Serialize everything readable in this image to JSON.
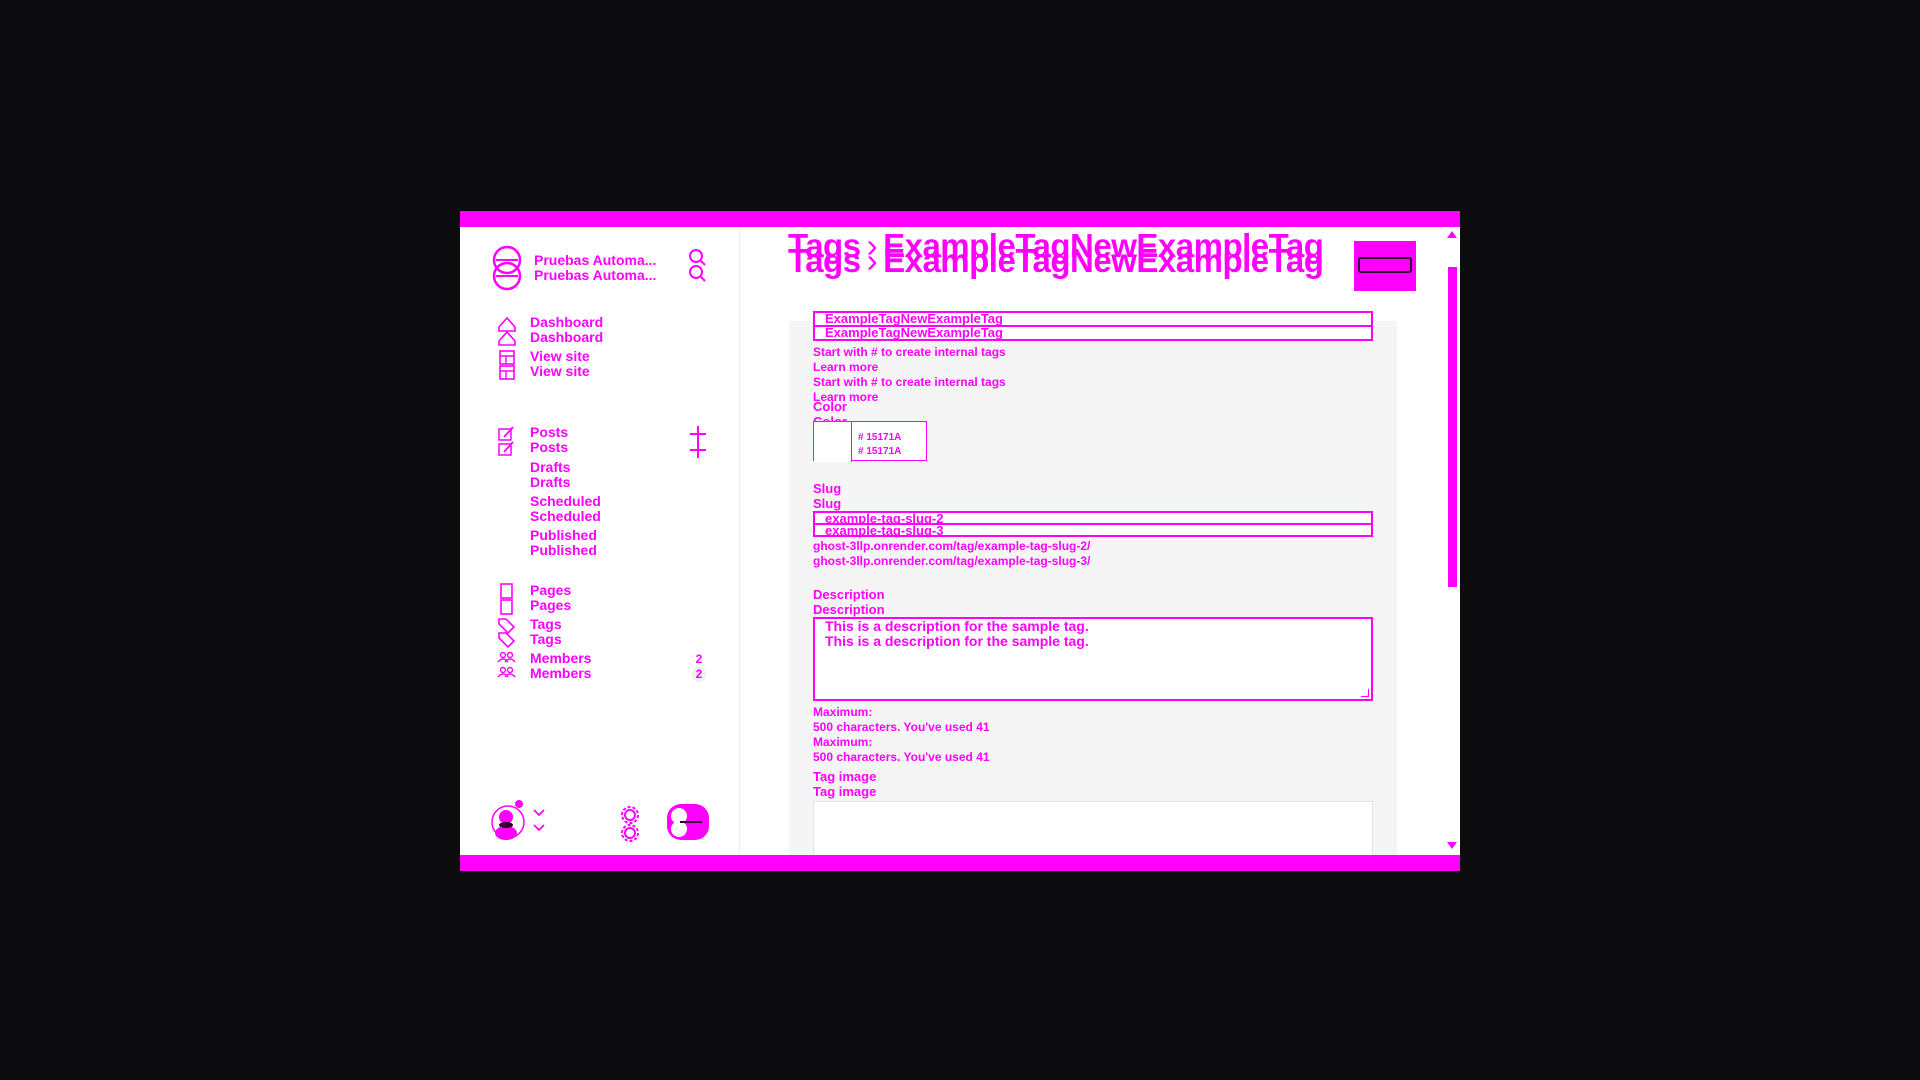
{
  "sidebar": {
    "brand": {
      "name": "Pruebas Automa...",
      "logo_icon": "ghost-logo-icon"
    },
    "search_icon": "search-icon",
    "nav_main": [
      {
        "label": "Dashboard",
        "icon": "home-icon"
      },
      {
        "label": "View site",
        "icon": "layout-icon"
      }
    ],
    "posts": {
      "label": "Posts",
      "icon": "edit-icon",
      "add_icon": "plus-icon",
      "sub_items": [
        "Drafts",
        "Scheduled",
        "Published"
      ]
    },
    "nav_content": [
      {
        "label": "Pages",
        "icon": "pages-icon"
      },
      {
        "label": "Tags",
        "icon": "tag-icon"
      },
      {
        "label": "Members",
        "icon": "members-icon",
        "count": "2"
      }
    ],
    "footer": {
      "avatar_icon": "user-avatar-icon",
      "chevron_icon": "chevron-down-icon",
      "settings_icon": "gear-icon",
      "theme_icon": "toggle-icon"
    }
  },
  "header": {
    "crumb_parent": "Tags",
    "crumb_sep": "›",
    "crumb_current": "ExampleTagNewExampleTag"
  },
  "form": {
    "name": {
      "value": "ExampleTagNewExampleTag",
      "hint_text": "Start with # to create internal tags",
      "hint_link": "Learn more"
    },
    "color": {
      "label": "Color",
      "value": "# 15171A"
    },
    "slug": {
      "label": "Slug",
      "value_prev": "example-tag-slug-2",
      "value": "example-tag-slug-3",
      "url_prev": "ghost-3llp.onrender.com/tag/example-tag-slug-2/",
      "url": "ghost-3llp.onrender.com/tag/example-tag-slug-3/"
    },
    "description": {
      "label": "Description",
      "value": "This is a description for the sample tag.",
      "counter_prefix": "Maximum:",
      "counter_max": "500",
      "counter_mid": "characters. You've used",
      "counter_used": "41"
    },
    "tag_image": {
      "label": "Tag image"
    }
  },
  "colors": {
    "accent": "#ff00ff",
    "background": "#0c0c0e",
    "panel": "#f5f5f6"
  }
}
